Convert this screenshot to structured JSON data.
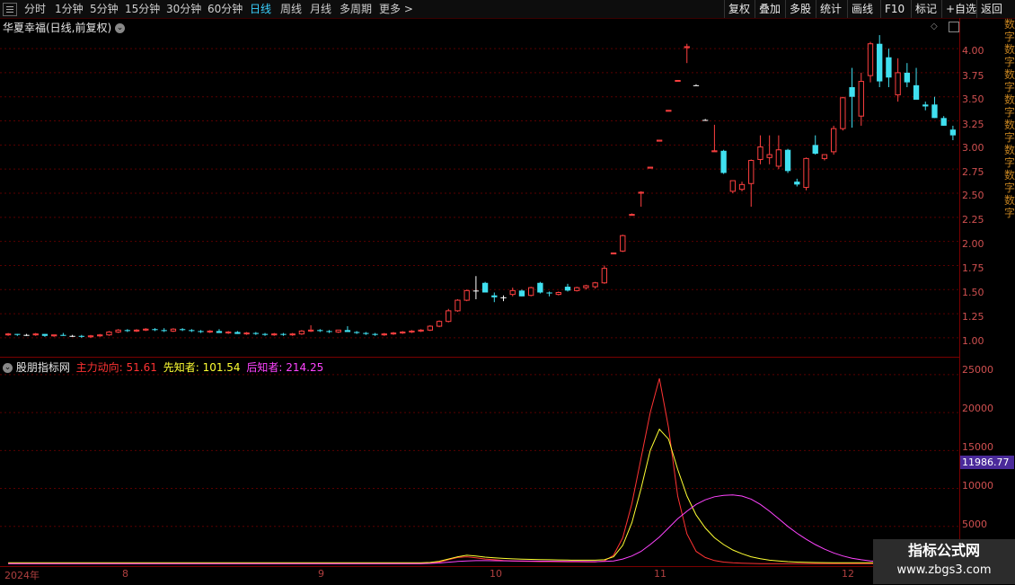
{
  "toolbar": {
    "periods": [
      "分时",
      "1分钟",
      "5分钟",
      "15分钟",
      "30分钟",
      "60分钟",
      "日线",
      "周线",
      "月线",
      "多周期",
      "更多 >"
    ],
    "active_period": "日线",
    "right_buttons": [
      "复权",
      "叠加",
      "多股",
      "统计",
      "画线",
      "F10",
      "标记",
      "+自选",
      "返回"
    ]
  },
  "stock": {
    "title": "华夏幸福(日线,前复权)"
  },
  "indicator": {
    "name": "股朋指标网",
    "items": [
      {
        "label": "主力动向: 51.61",
        "color": "#ff3333"
      },
      {
        "label": "先知者: 101.54",
        "color": "#ffff33"
      },
      {
        "label": "后知者: 214.25",
        "color": "#ff44ff"
      }
    ],
    "current_value": "11986.77"
  },
  "axes": {
    "price_ticks": [
      "4.00",
      "3.75",
      "3.50",
      "3.25",
      "3.00",
      "2.75",
      "2.50",
      "2.25",
      "2.00",
      "1.75",
      "1.50",
      "1.25",
      "1.00"
    ],
    "ind_ticks": [
      "25000",
      "20000",
      "15000",
      "10000",
      "5000"
    ],
    "x_labels": [
      "2024年",
      "8",
      "9",
      "10",
      "11",
      "12"
    ]
  },
  "right_strip": "数字数字数字数字数字数字数字数字",
  "watermark": {
    "line1": "指标公式网",
    "line2": "www.zbgs3.com"
  },
  "colors": {
    "up": "#ff4040",
    "down": "#40e0f0",
    "flat": "#ffffff",
    "grid": "#5a0000"
  },
  "chart_data": {
    "type": "candlestick",
    "price_range": [
      0.85,
      4.15
    ],
    "candles": [
      [
        1.03,
        1.05,
        1.02,
        1.04
      ],
      [
        1.04,
        1.04,
        1.02,
        1.03
      ],
      [
        1.03,
        1.04,
        1.02,
        1.03
      ],
      [
        1.03,
        1.05,
        1.02,
        1.04
      ],
      [
        1.04,
        1.04,
        1.01,
        1.02
      ],
      [
        1.02,
        1.03,
        1.01,
        1.03
      ],
      [
        1.03,
        1.05,
        1.02,
        1.02
      ],
      [
        1.02,
        1.03,
        1.01,
        1.02
      ],
      [
        1.02,
        1.03,
        1.0,
        1.01
      ],
      [
        1.01,
        1.03,
        1.0,
        1.02
      ],
      [
        1.02,
        1.04,
        1.01,
        1.03
      ],
      [
        1.03,
        1.07,
        1.02,
        1.06
      ],
      [
        1.06,
        1.09,
        1.05,
        1.08
      ],
      [
        1.08,
        1.09,
        1.06,
        1.07
      ],
      [
        1.07,
        1.09,
        1.06,
        1.08
      ],
      [
        1.08,
        1.1,
        1.07,
        1.09
      ],
      [
        1.09,
        1.1,
        1.07,
        1.08
      ],
      [
        1.08,
        1.1,
        1.06,
        1.07
      ],
      [
        1.07,
        1.1,
        1.06,
        1.09
      ],
      [
        1.09,
        1.1,
        1.07,
        1.08
      ],
      [
        1.08,
        1.09,
        1.06,
        1.07
      ],
      [
        1.07,
        1.08,
        1.05,
        1.06
      ],
      [
        1.06,
        1.08,
        1.05,
        1.07
      ],
      [
        1.07,
        1.09,
        1.05,
        1.05
      ],
      [
        1.05,
        1.07,
        1.04,
        1.06
      ],
      [
        1.06,
        1.07,
        1.04,
        1.04
      ],
      [
        1.04,
        1.06,
        1.03,
        1.05
      ],
      [
        1.05,
        1.06,
        1.03,
        1.04
      ],
      [
        1.04,
        1.05,
        1.02,
        1.03
      ],
      [
        1.03,
        1.05,
        1.02,
        1.04
      ],
      [
        1.04,
        1.05,
        1.02,
        1.03
      ],
      [
        1.03,
        1.05,
        1.02,
        1.04
      ],
      [
        1.04,
        1.08,
        1.03,
        1.07
      ],
      [
        1.07,
        1.13,
        1.06,
        1.08
      ],
      [
        1.08,
        1.09,
        1.06,
        1.07
      ],
      [
        1.07,
        1.08,
        1.05,
        1.06
      ],
      [
        1.06,
        1.08,
        1.05,
        1.08
      ],
      [
        1.08,
        1.12,
        1.06,
        1.06
      ],
      [
        1.06,
        1.07,
        1.04,
        1.05
      ],
      [
        1.05,
        1.06,
        1.03,
        1.04
      ],
      [
        1.04,
        1.05,
        1.02,
        1.03
      ],
      [
        1.03,
        1.05,
        1.02,
        1.04
      ],
      [
        1.04,
        1.06,
        1.03,
        1.05
      ],
      [
        1.05,
        1.07,
        1.04,
        1.06
      ],
      [
        1.06,
        1.08,
        1.05,
        1.07
      ],
      [
        1.07,
        1.09,
        1.06,
        1.08
      ],
      [
        1.08,
        1.13,
        1.07,
        1.12
      ],
      [
        1.12,
        1.18,
        1.11,
        1.17
      ],
      [
        1.17,
        1.3,
        1.16,
        1.28
      ],
      [
        1.28,
        1.4,
        1.27,
        1.39
      ],
      [
        1.39,
        1.5,
        1.38,
        1.49
      ],
      [
        1.49,
        1.64,
        1.4,
        1.49
      ],
      [
        1.57,
        1.58,
        1.47,
        1.47
      ],
      [
        1.44,
        1.47,
        1.37,
        1.42
      ],
      [
        1.42,
        1.44,
        1.38,
        1.42
      ],
      [
        1.45,
        1.52,
        1.43,
        1.49
      ],
      [
        1.49,
        1.5,
        1.43,
        1.43
      ],
      [
        1.44,
        1.53,
        1.43,
        1.52
      ],
      [
        1.57,
        1.58,
        1.46,
        1.47
      ],
      [
        1.47,
        1.48,
        1.43,
        1.46
      ],
      [
        1.45,
        1.48,
        1.44,
        1.47
      ],
      [
        1.53,
        1.56,
        1.48,
        1.49
      ],
      [
        1.49,
        1.53,
        1.48,
        1.52
      ],
      [
        1.52,
        1.55,
        1.5,
        1.54
      ],
      [
        1.53,
        1.58,
        1.51,
        1.57
      ],
      [
        1.57,
        1.75,
        1.56,
        1.72
      ],
      [
        1.87,
        1.88,
        1.87,
        1.88
      ],
      [
        1.9,
        2.07,
        1.89,
        2.06
      ],
      [
        2.27,
        2.29,
        2.27,
        2.28
      ],
      [
        2.5,
        2.52,
        2.36,
        2.51
      ],
      [
        2.76,
        2.77,
        2.76,
        2.77
      ],
      [
        3.04,
        3.05,
        3.04,
        3.05
      ],
      [
        3.35,
        3.36,
        3.35,
        3.36
      ],
      [
        3.66,
        3.67,
        3.66,
        3.67
      ],
      [
        4.01,
        4.05,
        3.85,
        4.02
      ],
      [
        3.62,
        3.63,
        3.62,
        3.62
      ],
      [
        3.26,
        3.27,
        3.26,
        3.26
      ],
      [
        2.93,
        3.21,
        2.93,
        2.94
      ],
      [
        2.94,
        2.95,
        2.7,
        2.71
      ],
      [
        2.52,
        2.63,
        2.5,
        2.63
      ],
      [
        2.54,
        2.62,
        2.52,
        2.59
      ],
      [
        2.6,
        2.85,
        2.36,
        2.84
      ],
      [
        2.85,
        3.1,
        2.8,
        2.98
      ],
      [
        2.87,
        3.1,
        2.8,
        2.9
      ],
      [
        2.78,
        3.1,
        2.75,
        2.95
      ],
      [
        2.95,
        2.96,
        2.71,
        2.73
      ],
      [
        2.62,
        2.65,
        2.57,
        2.59
      ],
      [
        2.56,
        2.87,
        2.53,
        2.86
      ],
      [
        3.0,
        3.1,
        2.9,
        2.91
      ],
      [
        2.86,
        2.9,
        2.84,
        2.9
      ],
      [
        2.93,
        3.2,
        2.9,
        3.17
      ],
      [
        3.17,
        3.5,
        3.15,
        3.49
      ],
      [
        3.6,
        3.8,
        3.18,
        3.5
      ],
      [
        3.3,
        3.75,
        3.2,
        3.66
      ],
      [
        3.72,
        4.07,
        3.65,
        4.05
      ],
      [
        4.05,
        4.14,
        3.6,
        3.66
      ],
      [
        3.91,
        4.0,
        3.6,
        3.7
      ],
      [
        3.52,
        3.9,
        3.45,
        3.75
      ],
      [
        3.75,
        3.85,
        3.6,
        3.65
      ],
      [
        3.62,
        3.8,
        3.52,
        3.47
      ],
      [
        3.42,
        3.45,
        3.36,
        3.4
      ],
      [
        3.42,
        3.5,
        3.28,
        3.28
      ],
      [
        3.28,
        3.3,
        3.2,
        3.2
      ],
      [
        3.16,
        3.2,
        3.05,
        3.1
      ]
    ],
    "indicator_range": [
      0,
      27000
    ],
    "series": [
      {
        "name": "主力动向",
        "color": "#ff3333",
        "values": [
          100,
          100,
          100,
          100,
          100,
          100,
          100,
          100,
          100,
          100,
          100,
          100,
          100,
          100,
          100,
          100,
          100,
          100,
          100,
          100,
          100,
          100,
          100,
          100,
          100,
          100,
          100,
          100,
          100,
          100,
          100,
          100,
          100,
          100,
          100,
          100,
          100,
          100,
          100,
          100,
          100,
          100,
          100,
          100,
          100,
          100,
          150,
          300,
          600,
          900,
          1000,
          850,
          700,
          600,
          500,
          450,
          400,
          380,
          360,
          350,
          340,
          330,
          320,
          310,
          310,
          450,
          1200,
          3500,
          8000,
          14000,
          20000,
          24500,
          18000,
          9000,
          4000,
          1700,
          900,
          500,
          300,
          200,
          150,
          120,
          100,
          100,
          100,
          100,
          100,
          100,
          100,
          100,
          100,
          100,
          100,
          100,
          100,
          100,
          100,
          100,
          100,
          100,
          100,
          100,
          100,
          100
        ]
      },
      {
        "name": "先知者",
        "color": "#ffff33",
        "values": [
          200,
          200,
          200,
          200,
          200,
          200,
          200,
          200,
          200,
          200,
          200,
          200,
          200,
          200,
          200,
          200,
          200,
          200,
          200,
          200,
          200,
          200,
          200,
          200,
          200,
          200,
          200,
          200,
          200,
          200,
          200,
          200,
          200,
          200,
          200,
          200,
          200,
          200,
          200,
          200,
          200,
          200,
          200,
          200,
          200,
          200,
          250,
          400,
          700,
          1000,
          1200,
          1100,
          950,
          850,
          780,
          720,
          680,
          650,
          620,
          600,
          580,
          560,
          550,
          540,
          540,
          600,
          1000,
          2500,
          5500,
          10000,
          15000,
          17800,
          16500,
          12500,
          9000,
          6500,
          4800,
          3500,
          2600,
          1900,
          1400,
          1000,
          750,
          550,
          450,
          350,
          300,
          260,
          240,
          220,
          210,
          200,
          200,
          200,
          200,
          200,
          200,
          200,
          200,
          200,
          200,
          200,
          200,
          200
        ]
      },
      {
        "name": "后知者",
        "color": "#ff44ff",
        "values": [
          100,
          100,
          100,
          100,
          100,
          100,
          100,
          100,
          100,
          100,
          100,
          100,
          100,
          100,
          100,
          100,
          100,
          100,
          100,
          100,
          100,
          100,
          100,
          100,
          100,
          100,
          100,
          100,
          100,
          100,
          100,
          100,
          100,
          100,
          100,
          100,
          100,
          100,
          100,
          100,
          100,
          100,
          100,
          100,
          100,
          100,
          120,
          180,
          280,
          380,
          450,
          480,
          480,
          470,
          460,
          450,
          440,
          430,
          420,
          410,
          400,
          390,
          380,
          370,
          360,
          380,
          450,
          700,
          1100,
          1700,
          2600,
          3600,
          4800,
          6000,
          7000,
          7900,
          8500,
          8900,
          9100,
          9150,
          9000,
          8600,
          7900,
          7000,
          6000,
          5000,
          4100,
          3300,
          2600,
          2000,
          1500,
          1100,
          800,
          600,
          450,
          350,
          300,
          270,
          250,
          240,
          230,
          220,
          210,
          200
        ]
      }
    ]
  }
}
